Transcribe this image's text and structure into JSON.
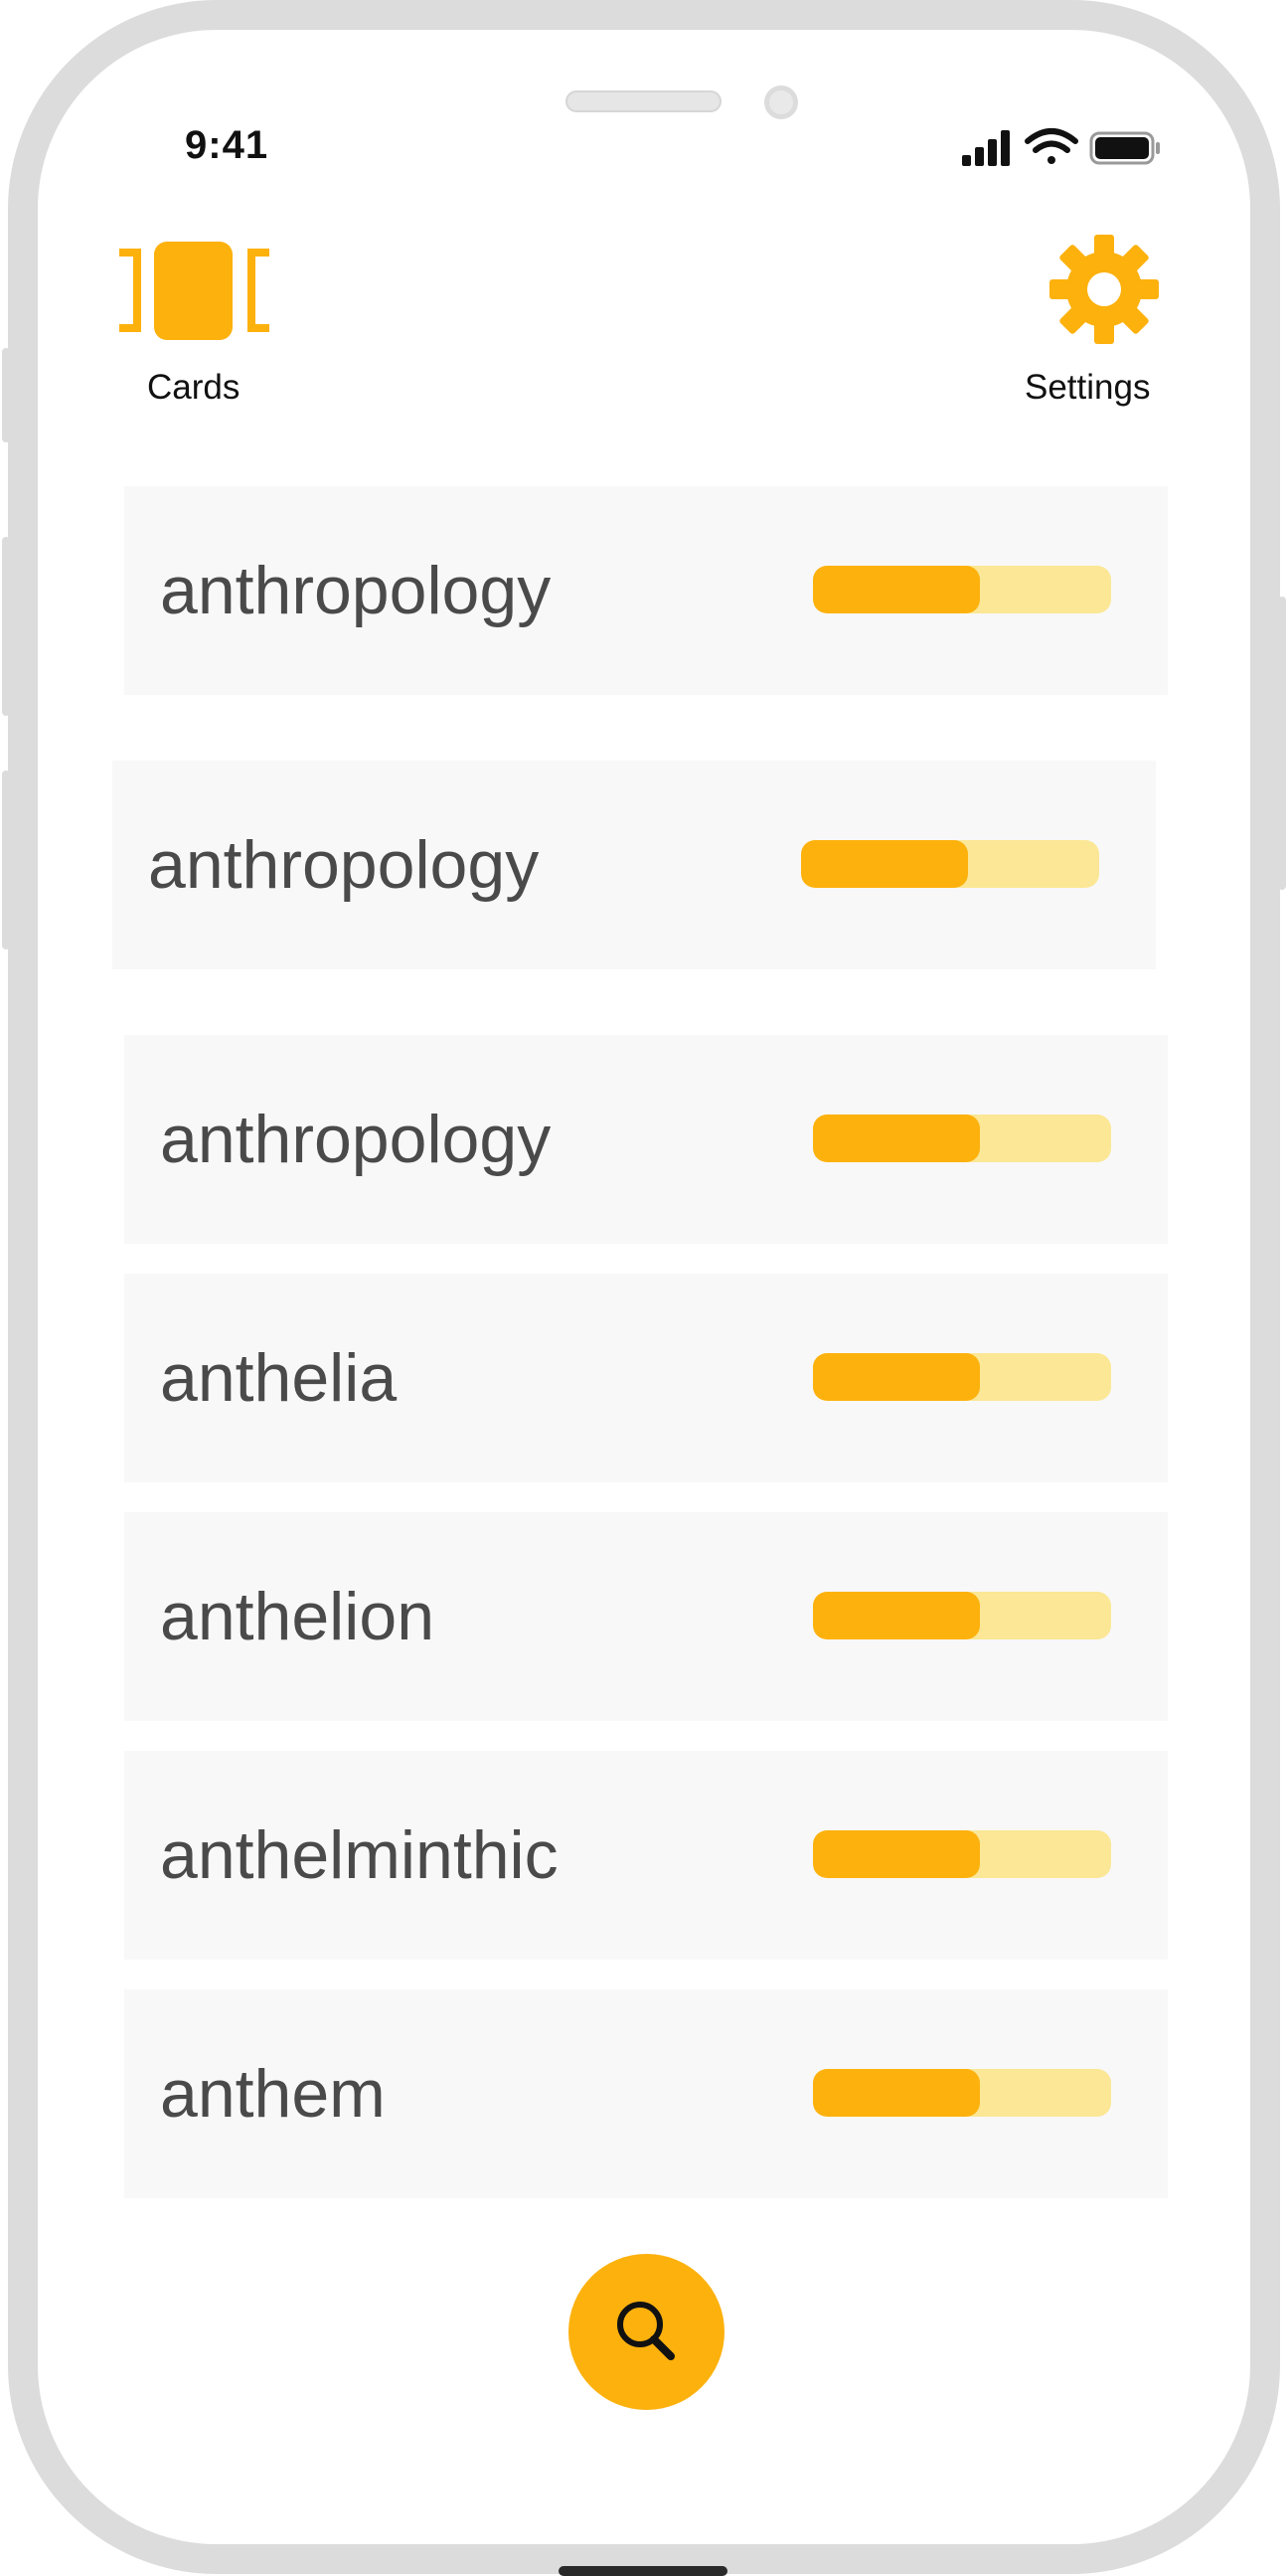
{
  "status_bar": {
    "time": "9:41",
    "icons": [
      "signal-icon",
      "wifi-icon",
      "battery-icon"
    ]
  },
  "nav": {
    "cards_label": "Cards",
    "cards_icon": "cards-icon",
    "settings_label": "Settings",
    "settings_icon": "gear-icon"
  },
  "words": [
    {
      "word": "anthropology",
      "progress": 0.56
    },
    {
      "word": "anthropology",
      "progress": 0.56
    },
    {
      "word": "anthropology",
      "progress": 0.56
    },
    {
      "word": "anthelia",
      "progress": 0.56
    },
    {
      "word": "anthelion",
      "progress": 0.56
    },
    {
      "word": "anthelminthic",
      "progress": 0.56
    },
    {
      "word": "anthem",
      "progress": 0.56
    }
  ],
  "search_button": {
    "icon": "search-icon"
  },
  "colors": {
    "accent": "#fdb10d",
    "accent_light": "#fbe795",
    "row_background": "#f8f8f8",
    "word_text": "#4a4a4a"
  }
}
